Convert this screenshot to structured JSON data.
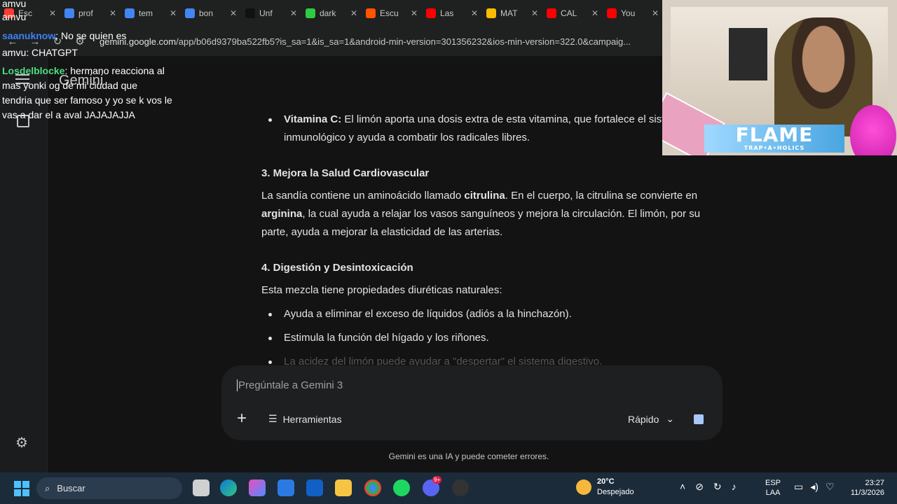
{
  "browser": {
    "tabs": [
      {
        "title": "Esc",
        "color": "#ff3b30"
      },
      {
        "title": "prof",
        "color": "#4285f4"
      },
      {
        "title": "tem",
        "color": "#4285f4"
      },
      {
        "title": "bon",
        "color": "#4285f4"
      },
      {
        "title": "Unf",
        "color": "#111111"
      },
      {
        "title": "dark",
        "color": "#2ecc40"
      },
      {
        "title": "Escu",
        "color": "#ff5500"
      },
      {
        "title": "Las",
        "color": "#ff0000"
      },
      {
        "title": "MAT",
        "color": "#fbbc04"
      },
      {
        "title": "CAL",
        "color": "#ff0000"
      },
      {
        "title": "You",
        "color": "#ff0000"
      }
    ],
    "url_host": "gemini.google.com",
    "url_path": "/app/b06d9379ba522fb5?is_sa=1&is_sa=1&android-min-version=301356232&ios-min-version=322.0&campaig..."
  },
  "app": {
    "title": "Gemini"
  },
  "content": {
    "vitc_label": "Vitamina C:",
    "vitc_text": " El limón aporta una dosis extra de esta vitamina, que fortalece el sistema inmunológico y ayuda a combatir los radicales libres.",
    "section3_title": "3. Mejora la Salud Cardiovascular",
    "s3_p1": "La sandía contiene un aminoácido llamado ",
    "s3_b1": "citrulina",
    "s3_p2": ". En el cuerpo, la citrulina se convierte en ",
    "s3_b2": "arginina",
    "s3_p3": ", la cual ayuda a relajar los vasos sanguíneos y mejora la circulación. El limón, por su parte, ayuda a mejorar la elasticidad de las arterias.",
    "section4_title": "4. Digestión y Desintoxicación",
    "s4_intro": "Esta mezcla tiene propiedades diuréticas naturales:",
    "s4_items": [
      "Ayuda a eliminar el exceso de líquidos (adiós a la hinchazón).",
      "Estimula la función del hígado y los riñones.",
      "La acidez del limón puede ayudar a \"despertar\" el sistema digestivo."
    ]
  },
  "composer": {
    "placeholder": "Pregúntale a Gemini 3",
    "tools_label": "Herramientas",
    "model_label": "Rápido"
  },
  "disclaimer": "Gemini es una IA y puede cometer errores.",
  "chat": {
    "lines": [
      {
        "user": "amvu",
        "text": ""
      },
      {
        "user": "amvu",
        "text": ""
      },
      {
        "user": "saanuknow",
        "text": ": No se quien es"
      },
      {
        "user": "amvu",
        "text": ": CHATGPT"
      },
      {
        "user": "Losdelblocke",
        "text": ": hermano reacciona al"
      },
      {
        "user": "",
        "text": "mas yonki og de mi ciudad que"
      },
      {
        "user": "",
        "text": "tendria que ser famoso y yo se k vos le"
      },
      {
        "user": "",
        "text": "vas a dar el a aval JAJAJAJJA"
      }
    ]
  },
  "webcam": {
    "banner": "FLAME",
    "banner_sub": "TRAP•A•HOLICS"
  },
  "taskbar": {
    "search_label": "Buscar",
    "weather_temp": "20°C",
    "weather_desc": "Despejado",
    "lang_top": "ESP",
    "lang_bottom": "LAA",
    "time": "23:27",
    "date": "11/3/2026",
    "discord_badge": "9+"
  }
}
